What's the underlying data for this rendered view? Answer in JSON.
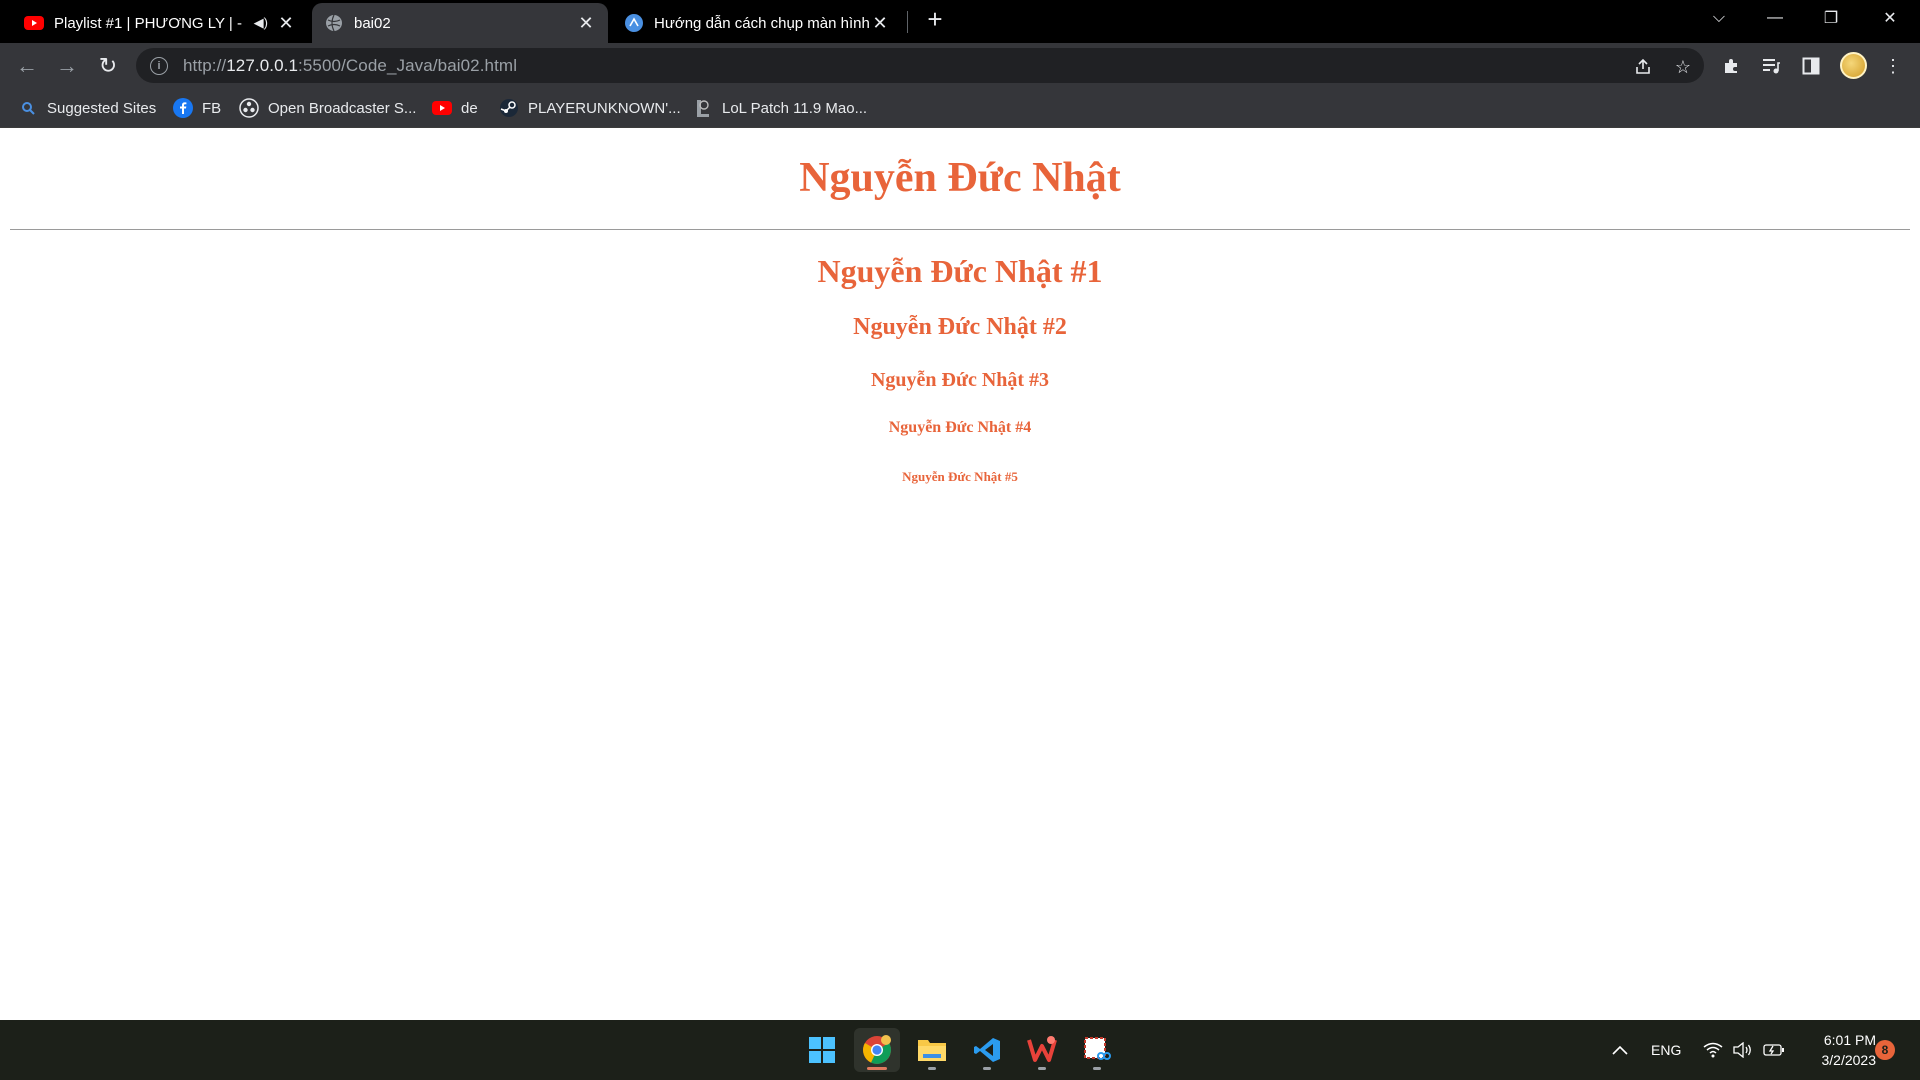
{
  "tabs": [
    {
      "title": "Playlist #1 | PHƯƠNG LY | - YouTube",
      "favicon": "youtube-icon",
      "muted_indicator": "speaker-icon"
    },
    {
      "title": "bai02",
      "favicon": "globe-icon",
      "active": true
    },
    {
      "title": "Hướng dẫn cách chụp màn hình",
      "favicon": "site-icon"
    }
  ],
  "window_controls": {
    "tab_search": "⌵",
    "minimize": "—",
    "restore": "❐",
    "close": "✕"
  },
  "toolbar": {
    "back": "←",
    "forward": "→",
    "reload": "↻",
    "url_prefix": "http://",
    "url_host": "127.0.0.1",
    "url_rest": ":5500/Code_Java/bai02.html",
    "share_icon": "share-icon",
    "star_icon": "star-icon",
    "extensions_icon": "puzzle-icon",
    "media_icon": "media-queue-icon",
    "sidepanel_icon": "side-panel-icon",
    "menu_icon": "kebab-menu-icon"
  },
  "bookmarks": [
    {
      "label": "Suggested Sites",
      "icon": "search-icon"
    },
    {
      "label": "FB",
      "icon": "facebook-icon"
    },
    {
      "label": "Open Broadcaster S...",
      "icon": "obs-icon"
    },
    {
      "label": "de",
      "icon": "youtube-icon"
    },
    {
      "label": "PLAYERUNKNOWN'...",
      "icon": "steam-icon"
    },
    {
      "label": "LoL Patch 11.9 Mao...",
      "icon": "lol-icon"
    }
  ],
  "page": {
    "title": "Nguyễn Đức Nhật",
    "headings": [
      "Nguyễn Đức Nhật #1",
      "Nguyễn Đức Nhật #2",
      "Nguyễn Đức Nhật #3",
      "Nguyễn Đức Nhật #4",
      "Nguyễn Đức Nhật #5"
    ],
    "accent_color": "#e8643a"
  },
  "taskbar": {
    "apps": [
      "windows-start-icon",
      "chrome-icon",
      "file-explorer-icon",
      "vscode-icon",
      "wps-office-icon",
      "snipping-tool-icon"
    ],
    "language": "ENG",
    "time": "6:01 PM",
    "date": "3/2/2023",
    "notification_count": "8"
  }
}
